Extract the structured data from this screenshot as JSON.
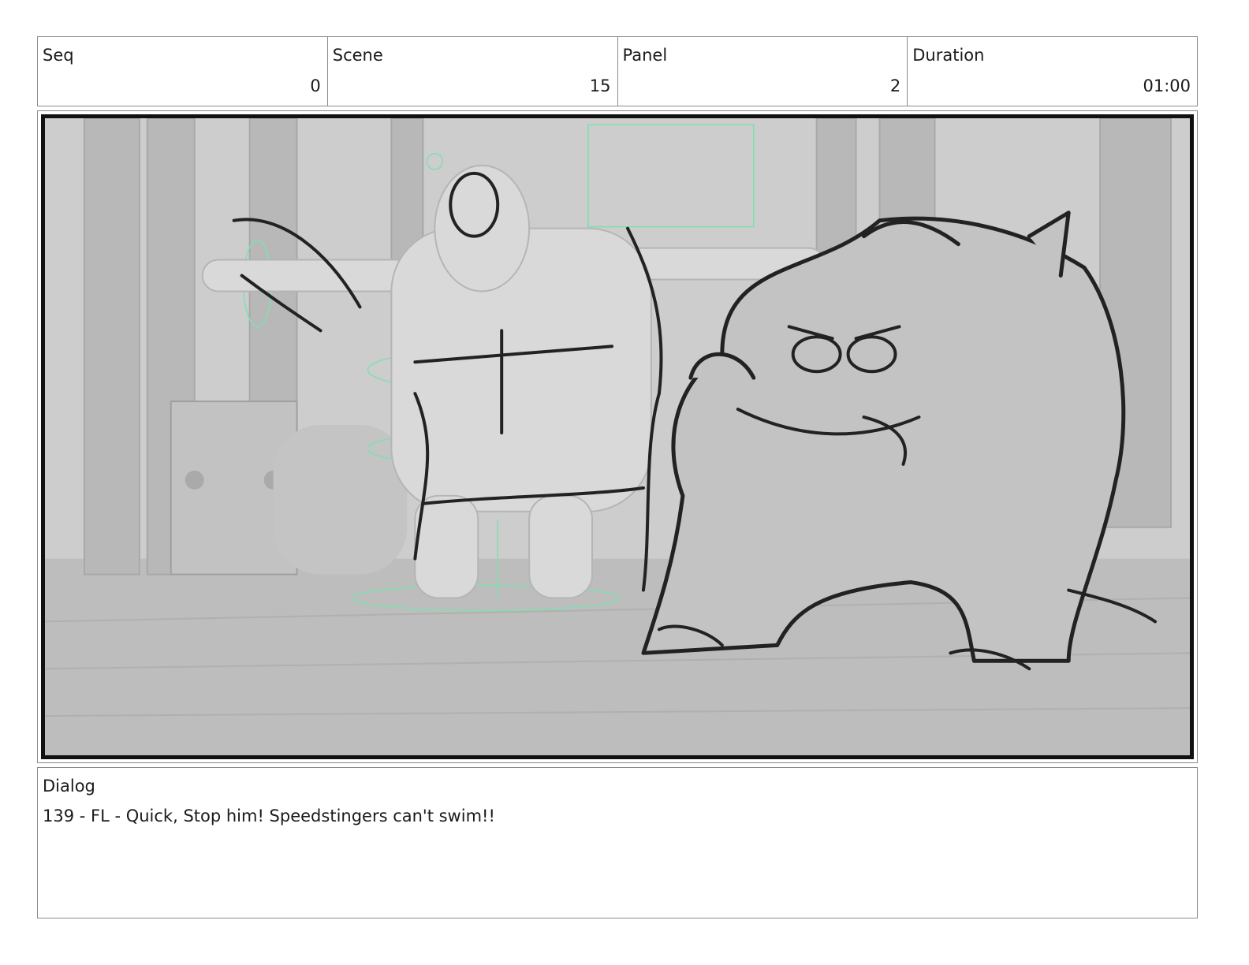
{
  "header": {
    "seq": {
      "label": "Seq",
      "value": "0"
    },
    "scene": {
      "label": "Scene",
      "value": "15"
    },
    "panel": {
      "label": "Panel",
      "value": "2"
    },
    "duration": {
      "label": "Duration",
      "value": "01:00"
    }
  },
  "panel_image": {
    "colors": {
      "background": "#c9c9c9",
      "ink": "#222222",
      "rig": "#7fe0b0",
      "frame": "#111111"
    }
  },
  "dialog": {
    "label": "Dialog",
    "text": "139 - FL - Quick, Stop him! Speedstingers can't swim!!"
  }
}
